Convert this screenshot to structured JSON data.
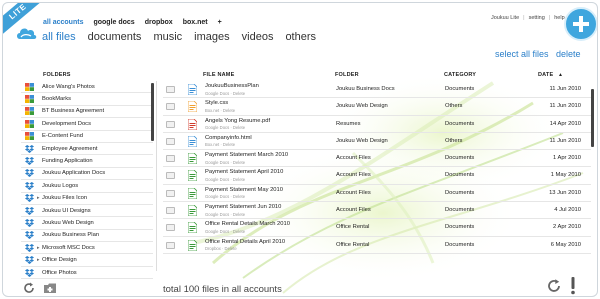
{
  "ribbon": "LITE",
  "source_tabs": [
    "all accounts",
    "google docs",
    "dropbox",
    "box.net",
    "+"
  ],
  "category_tabs": [
    "all files",
    "documents",
    "music",
    "images",
    "videos",
    "others"
  ],
  "top_links": {
    "user": "Joukuu Lite",
    "setting": "setting",
    "help": "help",
    "sep": "|"
  },
  "actions": {
    "select_all": "select all files",
    "delete": "delete"
  },
  "headers": {
    "folders": "FOLDERS",
    "file_name": "FILE NAME",
    "folder": "FOLDER",
    "category": "CATEGORY",
    "date": "DATE",
    "sort": "▲"
  },
  "folders": [
    {
      "label": "Alice Wang's Photos",
      "icon": "google-docs-icon",
      "arrow": ""
    },
    {
      "label": "BookMarks",
      "icon": "google-docs-icon",
      "arrow": ""
    },
    {
      "label": "BT Business Agreement",
      "icon": "google-docs-icon",
      "arrow": ""
    },
    {
      "label": "Development Docs",
      "icon": "google-docs-icon",
      "arrow": ""
    },
    {
      "label": "E-Content Fund",
      "icon": "google-docs-icon",
      "arrow": ""
    },
    {
      "label": "Employee Agreement",
      "icon": "dropbox-icon",
      "arrow": ""
    },
    {
      "label": "Funding Application",
      "icon": "dropbox-icon",
      "arrow": ""
    },
    {
      "label": "Joukuu Application Docs",
      "icon": "dropbox-icon",
      "arrow": ""
    },
    {
      "label": "Joukuu Logos",
      "icon": "dropbox-icon",
      "arrow": ""
    },
    {
      "label": "Joukuu Files Icon",
      "icon": "dropbox-icon",
      "arrow": "▸"
    },
    {
      "label": "Joukuu UI Designs",
      "icon": "dropbox-icon",
      "arrow": ""
    },
    {
      "label": "Joukuu Web Design",
      "icon": "dropbox-icon",
      "arrow": ""
    },
    {
      "label": "Joukuu Business Plan",
      "icon": "dropbox-icon",
      "arrow": ""
    },
    {
      "label": "Microsoft MSC Docs",
      "icon": "dropbox-icon",
      "arrow": "▸"
    },
    {
      "label": "Office Design",
      "icon": "dropbox-icon",
      "arrow": "▸"
    },
    {
      "label": "Office Photos",
      "icon": "dropbox-icon",
      "arrow": ""
    }
  ],
  "files": [
    {
      "name": "JoukuuBusinessPlan",
      "sub": "Google Docs · Delete",
      "folder": "Joukuu Business Docs",
      "category": "Documents",
      "date": "11 Jun 2010",
      "icon": "doc-icon",
      "color": "#3a8fd6"
    },
    {
      "name": "Style.css",
      "sub": "Box.net · Delete",
      "folder": "Joukuu Web Design",
      "category": "Others",
      "date": "11 Jun 2010",
      "icon": "css-icon",
      "color": "#f0a030"
    },
    {
      "name": "Angels Yong Resume.pdf",
      "sub": "Google Docs · Delete",
      "folder": "Resumes",
      "category": "Documents",
      "date": "14 Apr 2010",
      "icon": "pdf-icon",
      "color": "#d23a2a"
    },
    {
      "name": "Companyinfo.html",
      "sub": "Box.net · Delete",
      "folder": "Joukuu Web Design",
      "category": "Others",
      "date": "11 Jun 2010",
      "icon": "html-icon",
      "color": "#3a8fd6"
    },
    {
      "name": "Payment Statement March 2010",
      "sub": "Google Docs · Delete",
      "folder": "Account Files",
      "category": "Documents",
      "date": "1 Apr 2010",
      "icon": "sheet-icon",
      "color": "#3a9a3a"
    },
    {
      "name": "Payment Statement April 2010",
      "sub": "Google Docs · Delete",
      "folder": "Account Files",
      "category": "Documents",
      "date": "1 May 2010",
      "icon": "sheet-icon",
      "color": "#3a9a3a"
    },
    {
      "name": "Payment Statement May 2010",
      "sub": "Google Docs · Delete",
      "folder": "Account Files",
      "category": "Documents",
      "date": "13 Jun 2010",
      "icon": "sheet-icon",
      "color": "#3a9a3a"
    },
    {
      "name": "Payment Statement Jun 2010",
      "sub": "Google Docs · Delete",
      "folder": "Account Files",
      "category": "Documents",
      "date": "4 Jul 2010",
      "icon": "sheet-icon",
      "color": "#3a9a3a"
    },
    {
      "name": "Office Rental Details March 2010",
      "sub": "Google Docs · Delete",
      "folder": "Office Rental",
      "category": "Documents",
      "date": "2 Apr 2010",
      "icon": "sheet-icon",
      "color": "#3a9a3a"
    },
    {
      "name": "Office Rental Details April 2010",
      "sub": "Dropbox · Delete",
      "folder": "Office Rental",
      "category": "Documents",
      "date": "6 May 2010",
      "icon": "sheet-icon",
      "color": "#3a9a3a"
    }
  ],
  "footer": {
    "total": "total 100 files in all accounts"
  },
  "colors": {
    "accent": "#2a7fc9",
    "add_button": "#3fa6de",
    "ribbon": "#3fa0d8"
  }
}
